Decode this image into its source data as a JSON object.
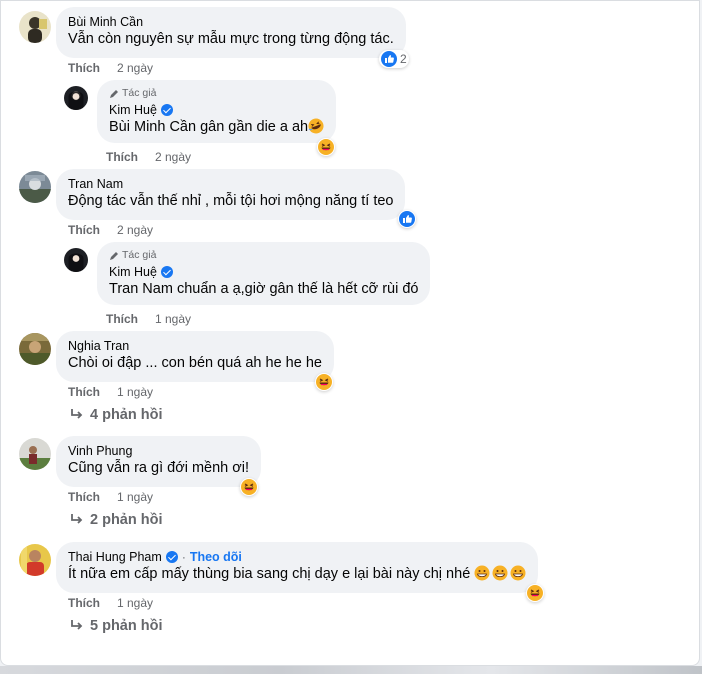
{
  "comments": [
    {
      "author": "Bùi Minh Cần",
      "text": "Vẫn còn nguyên sự mẫu mực trong từng động tác.",
      "like_label": "Thích",
      "time": "2 ngày",
      "reaction_count": "2",
      "reply": {
        "author_tag": "Tác giả",
        "author": "Kim Huệ",
        "mention": "Bùi Minh Cần",
        "text": " gân gần die a ah",
        "like_label": "Thích",
        "time": "2 ngày"
      }
    },
    {
      "author": "Tran Nam",
      "text": "Động tác vẫn thế nhỉ , mỗi tội hơi mộng năng tí teo",
      "like_label": "Thích",
      "time": "2 ngày",
      "reply": {
        "author_tag": "Tác giả",
        "author": "Kim Huệ",
        "mention": "Tran Nam",
        "text": " chuẩn a ạ,giờ gân thế là hết cỡ rùi đó",
        "like_label": "Thích",
        "time": "1 ngày"
      }
    },
    {
      "author": "Nghia Tran",
      "text": "Chòi oi đập ... con bén quá ah he he he",
      "like_label": "Thích",
      "time": "1 ngày",
      "replies_label": "4 phản hồi"
    },
    {
      "author": "Vinh Phung",
      "text": "Cũng vẫn ra gì đới mềnh ơi!",
      "like_label": "Thích",
      "time": "1 ngày",
      "replies_label": "2 phản hồi"
    },
    {
      "author": "Thai Hung Pham",
      "follow_label": "Theo dõi",
      "text": "Ít nữa em cấp mấy thùng bia sang chị dạy e lại bài này chị nhé",
      "like_label": "Thích",
      "time": "1 ngày",
      "replies_label": "5 phản hồi"
    }
  ],
  "colors": {
    "accent": "#1877f2",
    "bubble": "#f0f2f5",
    "meta_text": "#65676b",
    "haha": "#f7b125"
  },
  "icons": [
    "like-reaction-icon",
    "haha-reaction-icon",
    "verified-icon",
    "pencil-icon",
    "reply-arrow-icon",
    "grinning-emoji-icon",
    "rofl-emoji-icon"
  ]
}
